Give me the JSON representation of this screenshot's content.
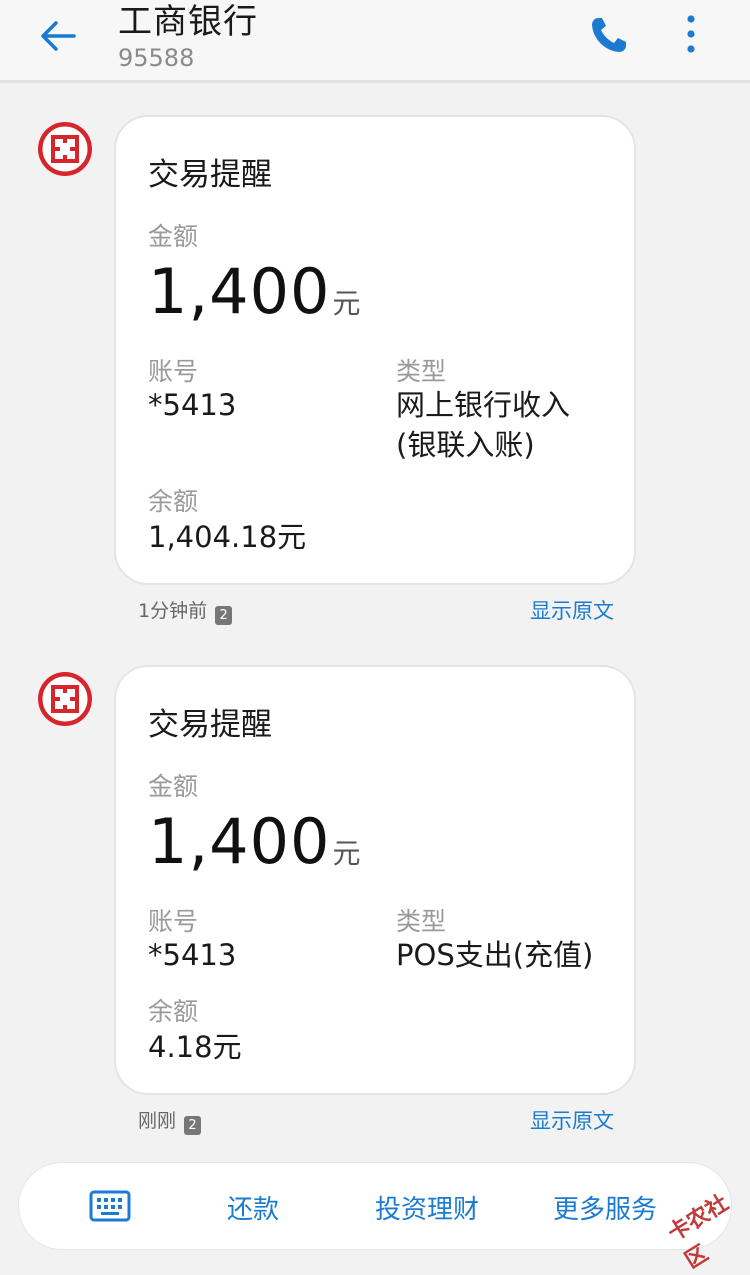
{
  "header": {
    "title": "工商银行",
    "number": "95588",
    "back_icon": "arrow-left-icon",
    "call_icon": "phone-icon",
    "menu_icon": "more-vertical-icon"
  },
  "messages": [
    {
      "title": "交易提醒",
      "amount_label": "金额",
      "amount": "1,400",
      "unit": "元",
      "account_label": "账号",
      "account": "*5413",
      "type_label": "类型",
      "type_line1": "网上银行收入",
      "type_line2": "(银联入账)",
      "balance_label": "余额",
      "balance": "1,404.18元",
      "time": "1分钟前",
      "sim": "2",
      "show_raw": "显示原文"
    },
    {
      "title": "交易提醒",
      "amount_label": "金额",
      "amount": "1,400",
      "unit": "元",
      "account_label": "账号",
      "account": "*5413",
      "type_label": "类型",
      "type_line1": "POS支出(充值)",
      "balance_label": "余额",
      "balance": "4.18元",
      "time": "刚刚",
      "sim": "2",
      "show_raw": "显示原文"
    }
  ],
  "bottom_bar": {
    "keyboard_icon": "keyboard-icon",
    "items": [
      "还款",
      "投资理财",
      "更多服务"
    ]
  },
  "watermark": "卡农社区",
  "colors": {
    "accent": "#1a7bd1",
    "brand_red": "#d6262b"
  }
}
